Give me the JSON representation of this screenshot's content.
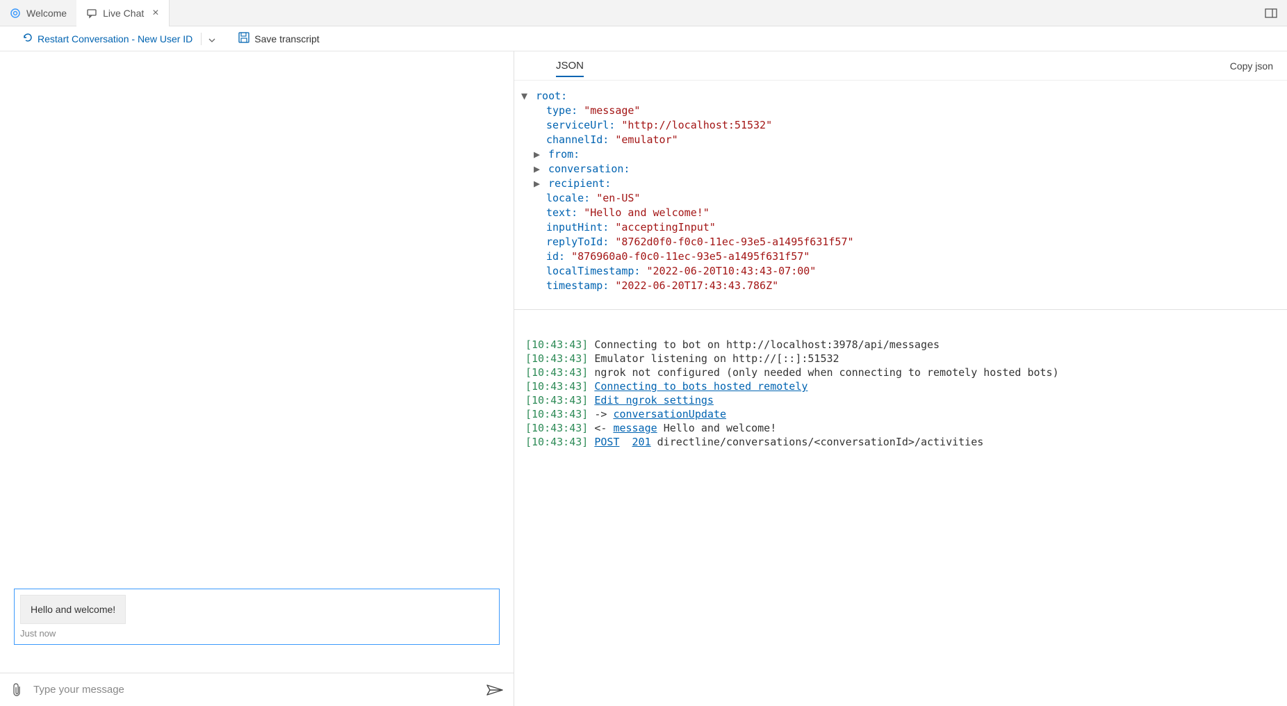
{
  "tabs": {
    "welcome": {
      "label": "Welcome"
    },
    "livechat": {
      "label": "Live Chat"
    }
  },
  "toolbar": {
    "restart": "Restart Conversation - New User ID",
    "save": "Save transcript"
  },
  "chat": {
    "message": "Hello and welcome!",
    "timestamp": "Just now",
    "placeholder": "Type your message"
  },
  "inspector": {
    "tab": "JSON",
    "copy": "Copy json"
  },
  "json": {
    "root": "root:",
    "type_k": "type:",
    "type_v": "\"message\"",
    "serviceUrl_k": "serviceUrl:",
    "serviceUrl_v": "\"http://localhost:51532\"",
    "channelId_k": "channelId:",
    "channelId_v": "\"emulator\"",
    "from_k": "from:",
    "conversation_k": "conversation:",
    "recipient_k": "recipient:",
    "locale_k": "locale:",
    "locale_v": "\"en-US\"",
    "text_k": "text:",
    "text_v": "\"Hello and welcome!\"",
    "inputHint_k": "inputHint:",
    "inputHint_v": "\"acceptingInput\"",
    "replyToId_k": "replyToId:",
    "replyToId_v": "\"8762d0f0-f0c0-11ec-93e5-a1495f631f57\"",
    "id_k": "id:",
    "id_v": "\"876960a0-f0c0-11ec-93e5-a1495f631f57\"",
    "localTimestamp_k": "localTimestamp:",
    "localTimestamp_v": "\"2022-06-20T10:43:43-07:00\"",
    "timestamp_k": "timestamp:",
    "timestamp_v": "\"2022-06-20T17:43:43.786Z\""
  },
  "log": {
    "ts": "[10:43:43]",
    "l1": "Connecting to bot on http://localhost:3978/api/messages",
    "l2": "Emulator listening on http://[::]:51532",
    "l3": "ngrok not configured (only needed when connecting to remotely hosted bots)",
    "l4_link": "Connecting to bots hosted remotely",
    "l5_link": "Edit ngrok settings",
    "l6_arrow": "->",
    "l6_link": "conversationUpdate",
    "l7_arrow": "<-",
    "l7_link": "message",
    "l7_text": "Hello and welcome!",
    "l8_post": "POST",
    "l8_code": "201",
    "l8_text": "directline/conversations/<conversationId>/activities"
  }
}
